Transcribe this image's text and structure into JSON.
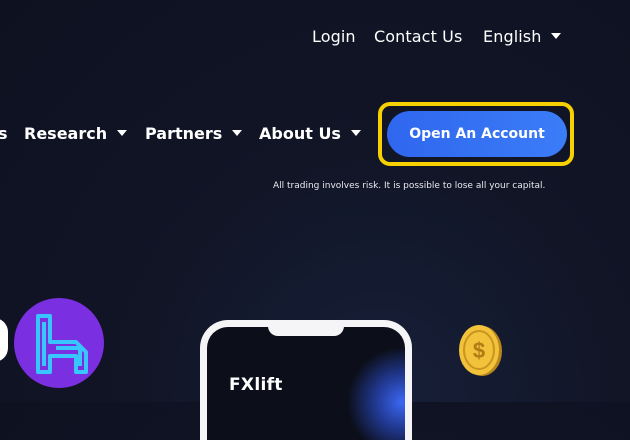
{
  "topbar": {
    "login": "Login",
    "contact": "Contact Us",
    "language": "English"
  },
  "nav": {
    "partial_item": "s",
    "items": [
      {
        "label": "Research"
      },
      {
        "label": "Partners"
      },
      {
        "label": "About Us"
      }
    ]
  },
  "cta": {
    "label": "Open An Account",
    "highlight_color": "#f7d000",
    "color": "#3370f2"
  },
  "risk_warning": "All trading involves risk. It is possible to lose all your capital.",
  "phone": {
    "brand": "FXlift"
  },
  "icons": {
    "overlay_logo": "tradingfinder-logo-icon",
    "coin": "dollar-coin-icon"
  },
  "colors": {
    "background": "#111526",
    "logo_purple": "#7a2fe0",
    "logo_cyan": "#39c6ff"
  }
}
